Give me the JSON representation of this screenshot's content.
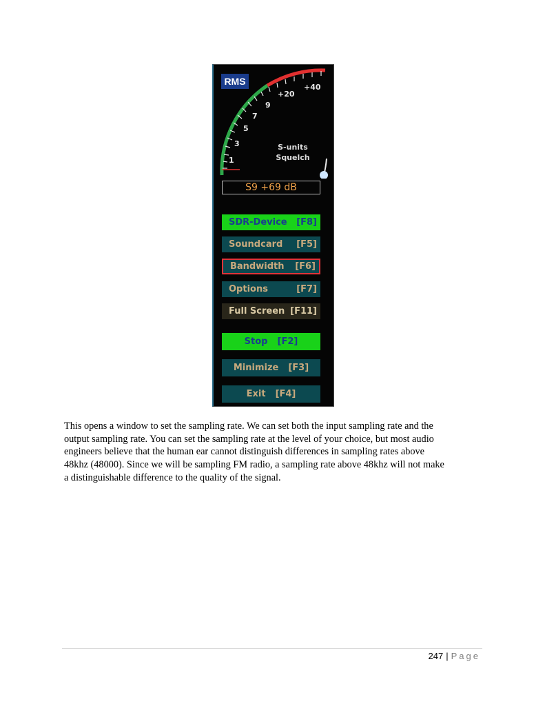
{
  "panel": {
    "rms_label": "RMS",
    "scale_labels": [
      "1",
      "3",
      "5",
      "7",
      "9",
      "+20",
      "+40"
    ],
    "meter_caption_line1": "S-units",
    "meter_caption_line2": "Squelch",
    "readout": "S9 +69 dB",
    "buttons": [
      {
        "label": "SDR-Device",
        "key": "[F8]"
      },
      {
        "label": "Soundcard",
        "key": "[F5]"
      },
      {
        "label": "Bandwidth",
        "key": "[F6]"
      },
      {
        "label": "Options",
        "key": "[F7]"
      },
      {
        "label": "Full Screen",
        "key": "[F11]"
      },
      {
        "label": "Stop",
        "key": "[F2]"
      },
      {
        "label": "Minimize",
        "key": "[F3]"
      },
      {
        "label": "Exit",
        "key": "[F4]"
      }
    ]
  },
  "paragraph": {
    "lines": [
      "This opens a window to set the sampling rate. We can set both the input sampling rate and the",
      "output sampling rate. You can set the sampling rate at the level of your choice, but most audio",
      "engineers believe that the human ear cannot distinguish differences in sampling rates above",
      "48khz (48000). Since we will be sampling FM radio, a sampling rate above 48khz will not make",
      "a distinguishable difference to the quality of the signal."
    ]
  },
  "footer": {
    "page_number": "247",
    "separator": "|",
    "page_word": "Page"
  },
  "colors": {
    "panel_bg": "#050505",
    "button_teal": "#0c4950",
    "button_green": "#19d219",
    "button_active_border": "#e0343a",
    "readout_text": "#f0a24a",
    "scale_green": "#2ea84a",
    "scale_red": "#e23030"
  }
}
